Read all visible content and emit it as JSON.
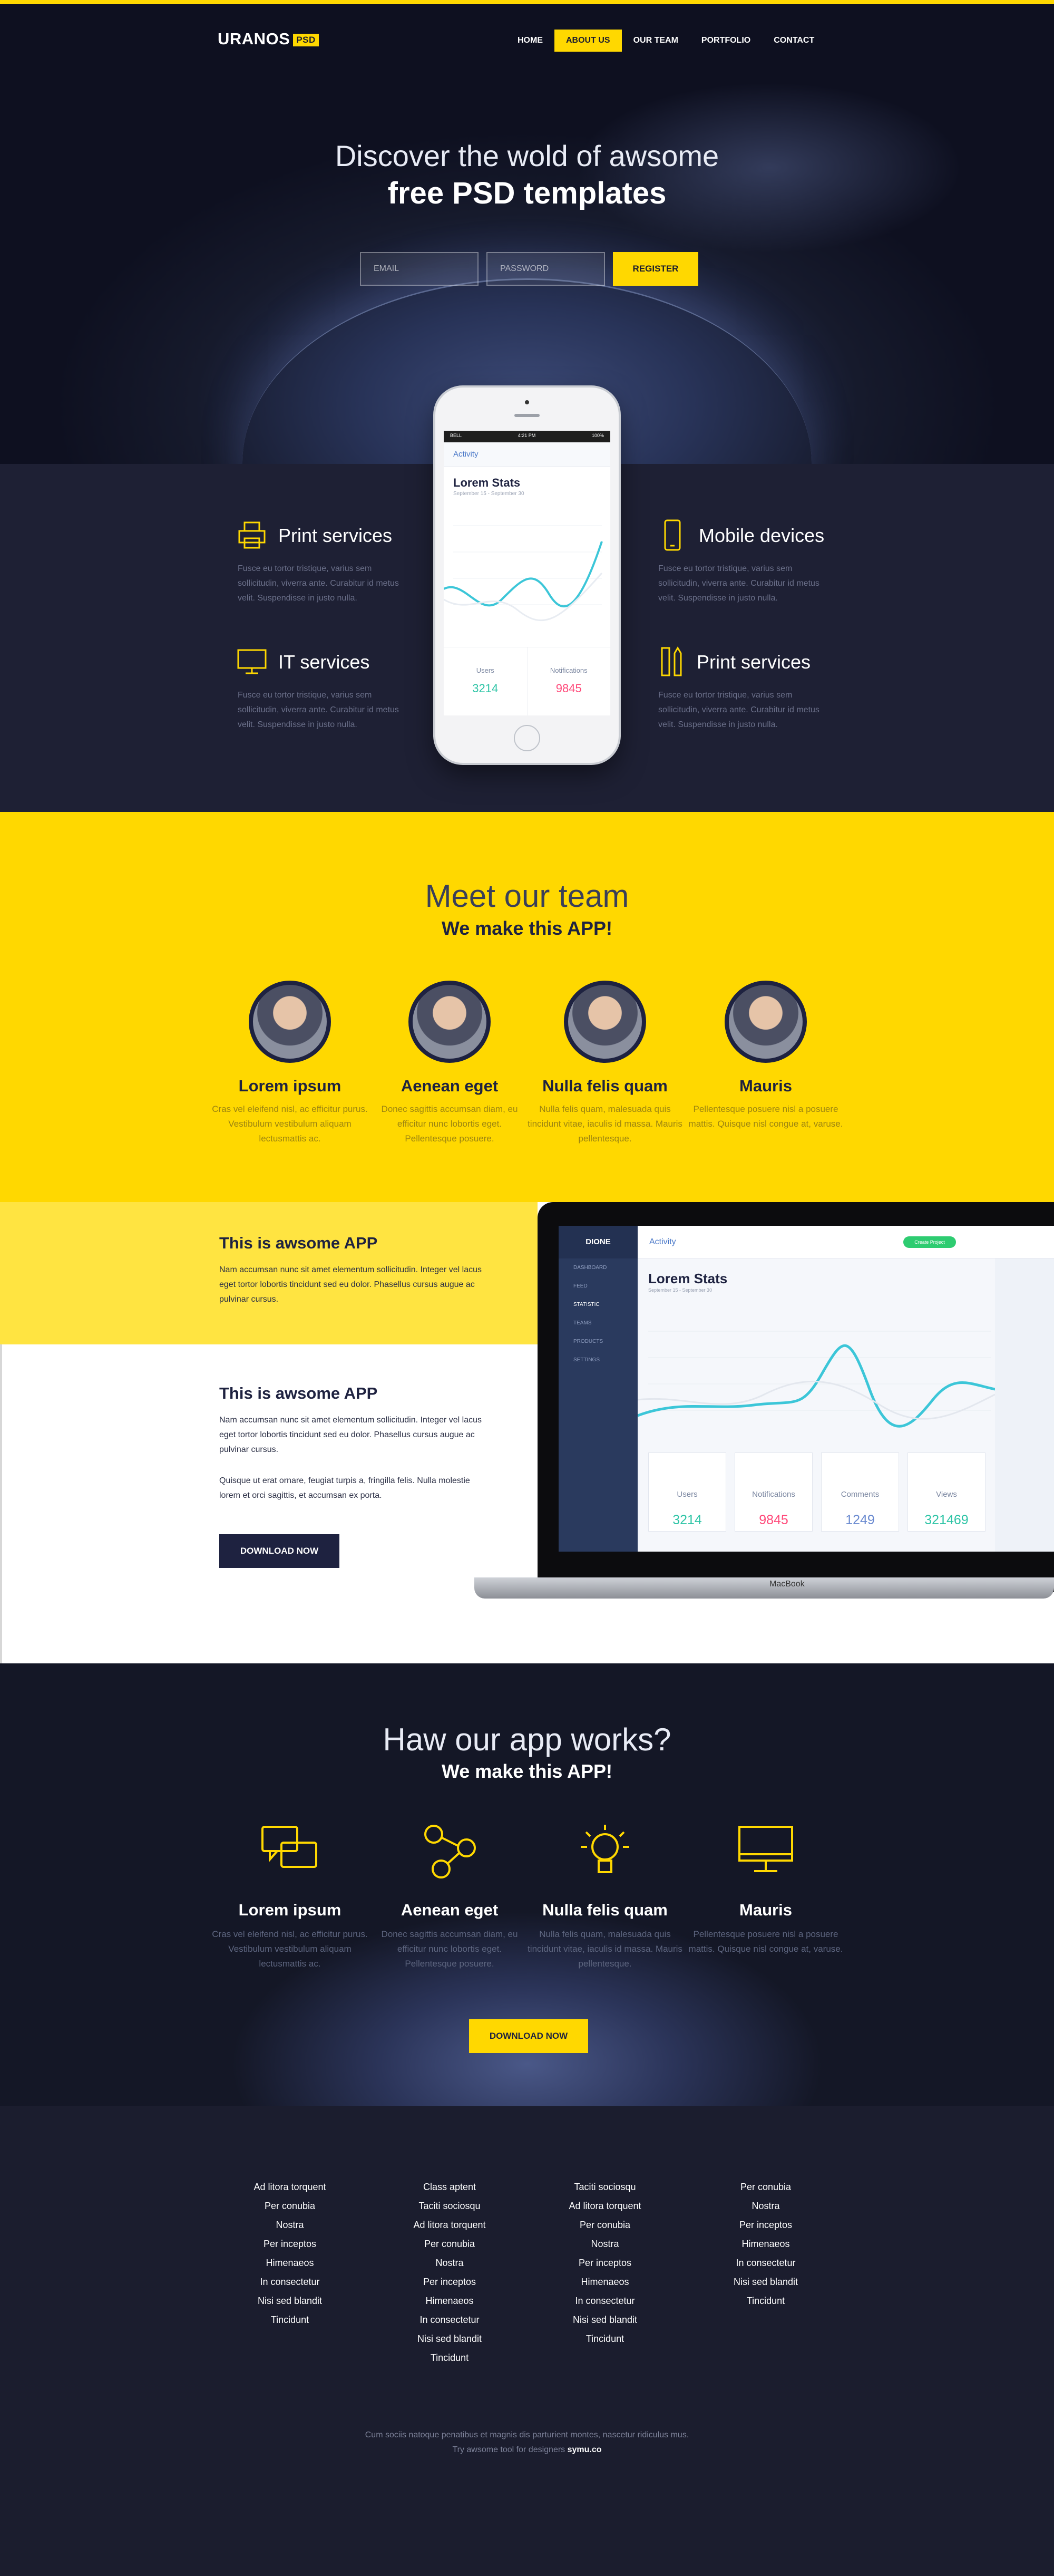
{
  "brand": {
    "name": "URANOS",
    "badge": "PSD"
  },
  "nav": [
    {
      "label": "HOME"
    },
    {
      "label": "ABOUT US"
    },
    {
      "label": "OUR TEAM"
    },
    {
      "label": "PORTFOLIO"
    },
    {
      "label": "CONTACT"
    }
  ],
  "hero": {
    "line1": "Discover the wold of awsome",
    "line2": "free PSD templates",
    "email_placeholder": "EMAIL",
    "password_placeholder": "PASSWORD",
    "register": "REGISTER"
  },
  "services": [
    {
      "title": "Print services",
      "icon": "printer-icon",
      "text": "Fusce eu tortor tristique, varius sem sollicitudin, viverra ante. Curabitur id metus velit. Suspendisse in justo nulla."
    },
    {
      "title": "IT services",
      "icon": "monitor-icon",
      "text": "Fusce eu tortor tristique, varius sem sollicitudin, viverra ante. Curabitur id metus velit. Suspendisse in justo nulla."
    },
    {
      "title": "Mobile devices",
      "icon": "mobile-icon",
      "text": "Fusce eu tortor tristique, varius sem sollicitudin, viverra ante. Curabitur id metus velit. Suspendisse in justo nulla."
    },
    {
      "title": "Print services",
      "icon": "pencil-ruler-icon",
      "text": "Fusce eu tortor tristique, varius sem sollicitudin, viverra ante. Curabitur id metus velit. Suspendisse in justo nulla."
    }
  ],
  "phone": {
    "status_left": "BELL",
    "time": "4:21 PM",
    "battery": "100%",
    "app_bar": "Activity",
    "title": "Lorem Stats",
    "dates": "September 15 - September 30",
    "metrics": [
      {
        "label": "Users",
        "value": "3214",
        "color": "#2ec4a6"
      },
      {
        "label": "Notifications",
        "value": "9845",
        "color": "#ff4a7a"
      }
    ]
  },
  "team": {
    "title": "Meet our team",
    "subtitle": "We make this APP!",
    "members": [
      {
        "name": "Lorem ipsum",
        "text": "Cras vel eleifend nisl, ac efficitur purus. Vestibulum vestibulum aliquam lectusmattis ac."
      },
      {
        "name": "Aenean eget",
        "text": "Donec sagittis accumsan diam, eu efficitur nunc lobortis eget. Pellentesque posuere."
      },
      {
        "name": "Nulla felis quam",
        "text": "Nulla felis quam, malesuada quis tincidunt vitae, iaculis id massa. Mauris pellentesque."
      },
      {
        "name": "Mauris",
        "text": "Pellentesque posuere nisl a posuere mattis. Quisque nisl congue at, varuse."
      }
    ]
  },
  "app": {
    "title1": "This is awsome APP",
    "text1": "Nam accumsan nunc sit amet elementum sollicitudin. Integer vel lacus eget tortor lobortis tincidunt sed eu dolor. Phasellus cursus augue ac pulvinar cursus.",
    "title2": "This is awsome APP",
    "text2": "Nam accumsan nunc sit amet elementum sollicitudin. Integer vel lacus eget tortor lobortis tincidunt sed eu dolor. Phasellus cursus augue ac pulvinar cursus.",
    "text3": "Quisque ut erat ornare, feugiat turpis a, fringilla felis. Nulla molestie lorem et orci sagittis, et accumsan ex porta.",
    "button": "DOWNLOAD NOW"
  },
  "laptop": {
    "brand": "DIONE",
    "app_bar": "Activity",
    "create": "Create Project",
    "title": "Lorem Stats",
    "dates": "September 15 - September 30",
    "menu": [
      "DASHBOARD",
      "FEED",
      "STATISTIC",
      "TEAMS",
      "PRODUCTS",
      "SETTINGS"
    ],
    "metrics": [
      {
        "label": "Users",
        "value": "3214",
        "color": "#2ec4a6"
      },
      {
        "label": "Notifications",
        "value": "9845",
        "color": "#ff4a7a"
      },
      {
        "label": "Comments",
        "value": "1249",
        "color": "#6a8ad0"
      },
      {
        "label": "Views",
        "value": "321469",
        "color": "#2ec4a6"
      }
    ],
    "base_label": "MacBook"
  },
  "works": {
    "title": "Haw our app works?",
    "subtitle": "We make this APP!",
    "steps": [
      {
        "name": "Lorem ipsum",
        "icon": "chat-icon",
        "text": "Cras vel eleifend nisl, ac efficitur purus. Vestibulum vestibulum aliquam lectusmattis ac."
      },
      {
        "name": "Aenean eget",
        "icon": "share-icon",
        "text": "Donec sagittis accumsan diam, eu efficitur nunc lobortis eget. Pellentesque posuere."
      },
      {
        "name": "Nulla felis quam",
        "icon": "lightbulb-icon",
        "text": "Nulla felis quam, malesuada quis tincidunt vitae, iaculis id massa. Mauris pellentesque."
      },
      {
        "name": "Mauris",
        "icon": "monitor-icon",
        "text": "Pellentesque posuere nisl a posuere mattis. Quisque nisl congue at, varuse."
      }
    ],
    "button": "DOWNLOAD NOW"
  },
  "footer": {
    "columns": [
      [
        "Ad litora torquent",
        "Per conubia",
        "Nostra",
        "Per inceptos",
        "Himenaeos",
        "In consectetur",
        "Nisi sed blandit",
        "Tincidunt"
      ],
      [
        "Class aptent",
        "Taciti sociosqu",
        "Ad litora torquent",
        "Per conubia",
        "Nostra",
        "Per inceptos",
        "Himenaeos",
        "In consectetur",
        "Nisi sed blandit",
        "Tincidunt"
      ],
      [
        "Taciti sociosqu",
        "Ad litora torquent",
        "Per conubia",
        "Nostra",
        "Per inceptos",
        "Himenaeos",
        "In consectetur",
        "Nisi sed blandit",
        "Tincidunt"
      ],
      [
        "Per conubia",
        "Nostra",
        "Per inceptos",
        "Himenaeos",
        "In consectetur",
        "Nisi sed blandit",
        "Tincidunt"
      ]
    ],
    "copy1": "Cum sociis natoque penatibus et magnis dis parturient montes, nascetur ridiculus mus.",
    "copy2": "Try awsome tool for designers",
    "copy_brand": "symu.co"
  },
  "colors": {
    "accent": "#ffd800",
    "dark": "#1e2240"
  }
}
